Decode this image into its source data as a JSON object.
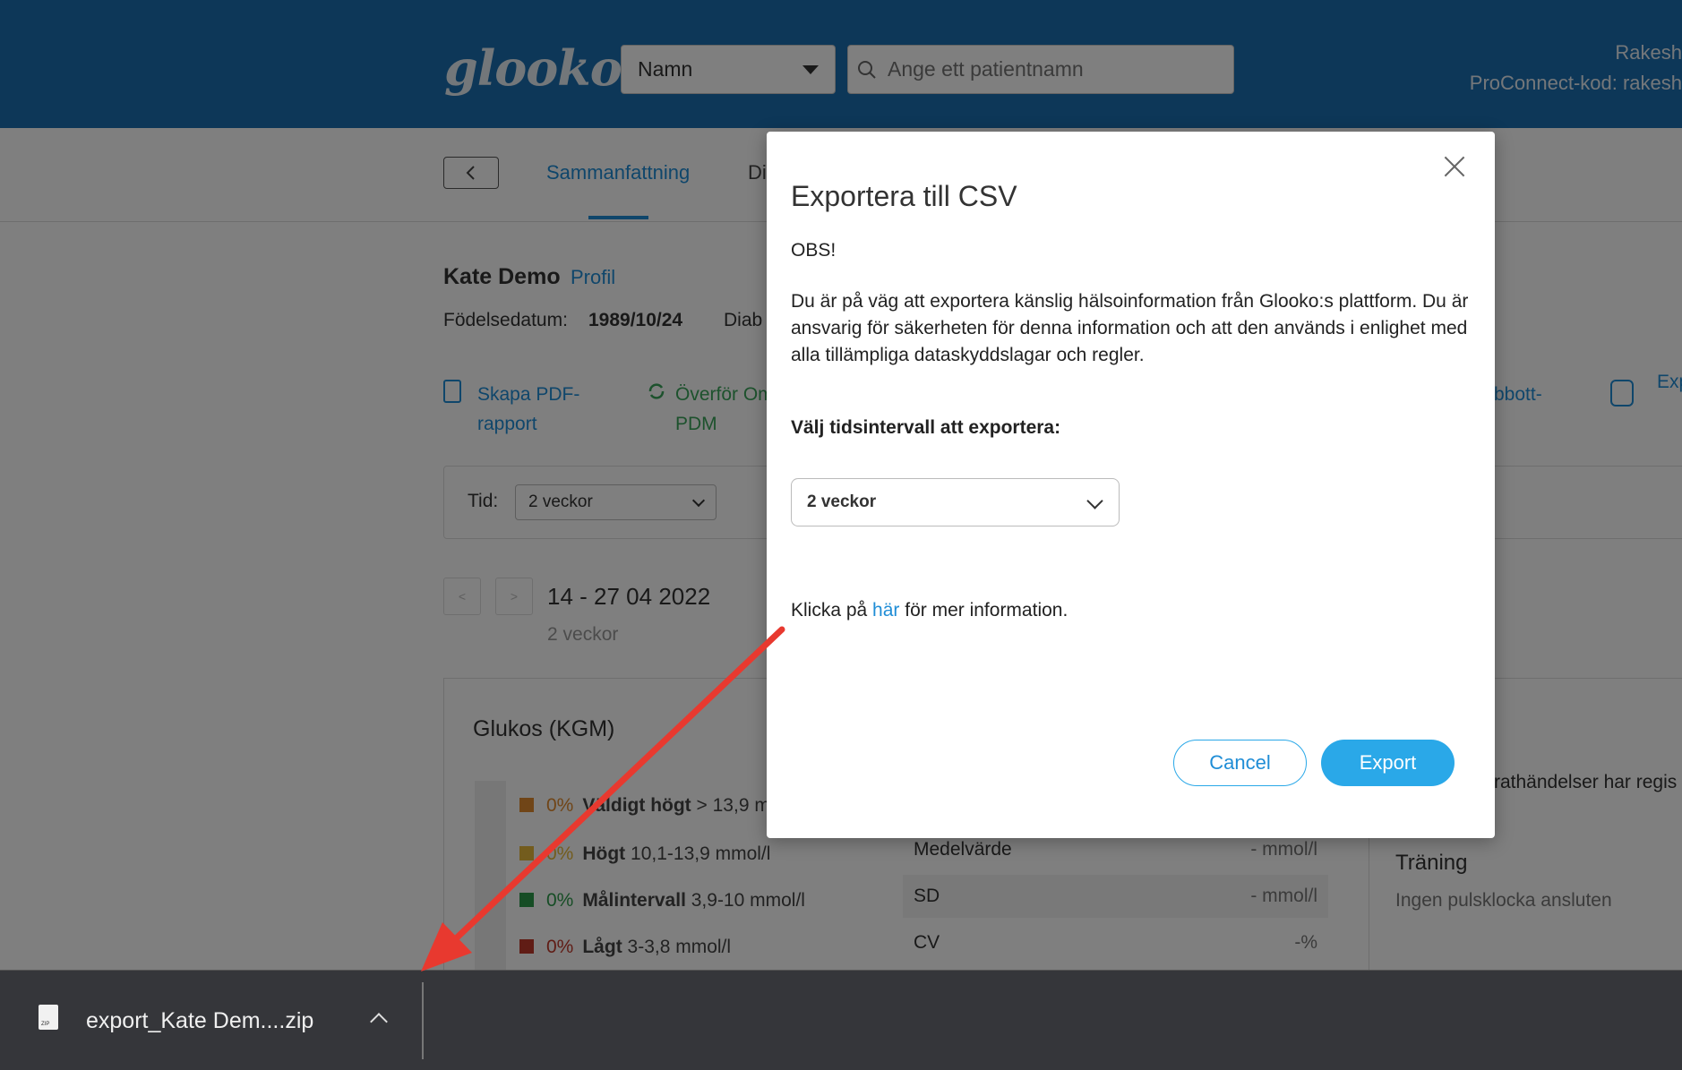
{
  "header": {
    "logo": "glooko",
    "name_select": "Namn",
    "search_placeholder": "Ange ett patientnamn",
    "user_line1": "Rakesh",
    "user_line2": "ProConnect-kod: rakesh"
  },
  "tabs": {
    "active": "Sammanfattning",
    "next": "Di"
  },
  "patient": {
    "name": "Kate Demo",
    "profile_link": "Profil",
    "dob_label": "Födelsedatum:",
    "dob_value": "1989/10/24",
    "diab": "Diab"
  },
  "actions": {
    "pdf_line1": "Skapa PDF-",
    "pdf_line2": "rapport",
    "transfer_line1": "Överför Om",
    "transfer_line2": "PDM",
    "abbott": "bbott-",
    "exp": "Exp"
  },
  "period": {
    "label": "Tid:",
    "value": "2 veckor",
    "prev": "<",
    "next": ">",
    "range": "14 - 27 04 2022",
    "sub": "2 veckor"
  },
  "glucose": {
    "title": "Glukos (KGM)",
    "rows": [
      {
        "pct": "0%",
        "label": "Väldigt högt",
        "range": "> 13,9 m",
        "color": "#e08a2e"
      },
      {
        "pct": "0%",
        "label": "Högt",
        "range": "10,1-13,9 mmol/l",
        "color": "#e6b83a"
      },
      {
        "pct": "0%",
        "label": "Målintervall",
        "range": "3,9-10 mmol/l",
        "color": "#2c9a4b"
      },
      {
        "pct": "0%",
        "label": "Lågt",
        "range": "3-3,8 mmol/l",
        "color": "#c0392b"
      }
    ],
    "stats": [
      {
        "label": "Medelvärde",
        "value": "- mmol/l"
      },
      {
        "label": "SD",
        "value": "- mmol/l"
      },
      {
        "label": "CV",
        "value": "-%"
      }
    ]
  },
  "right": {
    "events": "rathändelser har regis",
    "training_title": "Träning",
    "training_sub": "Ingen pulsklocka ansluten"
  },
  "modal": {
    "title": "Exportera till CSV",
    "obs": "OBS!",
    "body": "Du är på väg att exportera känslig hälsoinformation från Glooko:s plattform. Du är ansvarig för säkerheten för denna information och att den används i enlighet med alla tillämpliga dataskyddslagar och regler.",
    "range_label": "Välj tidsintervall att exportera:",
    "range_value": "2 veckor",
    "info_prefix": "Klicka på ",
    "info_link": "här",
    "info_suffix": " för mer information.",
    "cancel": "Cancel",
    "export": "Export"
  },
  "download": {
    "filename": "export_Kate Dem....zip",
    "icon_text": "ZIP"
  },
  "colors": {
    "header_blue": "#1a6fb0",
    "accent": "#2aa8e8",
    "annotation_arrow": "#e8392f"
  }
}
